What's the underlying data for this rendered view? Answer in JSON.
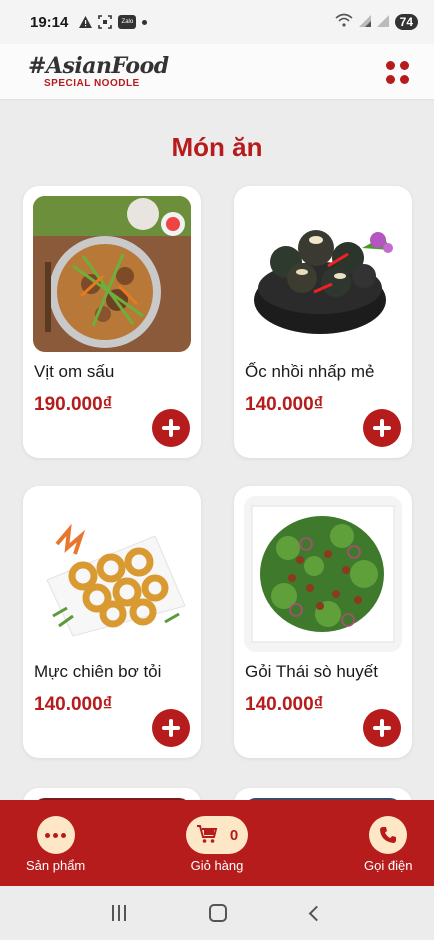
{
  "status_bar": {
    "time": "19:14",
    "battery": "74",
    "left_icons": [
      "alert-icon",
      "screenshot-icon",
      "zalo-icon",
      "dot-icon"
    ],
    "zalo_label": "Zalo"
  },
  "header": {
    "logo_main": "#AsianFood",
    "logo_sub": "SPECIAL NOODLE",
    "menu_icon": "grid-dots-icon"
  },
  "main": {
    "section_title": "Món ăn",
    "dishes": [
      {
        "name": "Vịt om sấu",
        "price": "190.000₫"
      },
      {
        "name": "Ốc nhồi nhấp mẻ",
        "price": "140.000₫"
      },
      {
        "name": "Mực chiên bơ tỏi",
        "price": "140.000₫"
      },
      {
        "name": "Gỏi Thái sò huyết",
        "price": "140.000₫"
      }
    ]
  },
  "bottom_nav": {
    "products_label": "Sản phẩm",
    "cart_label": "Giỏ hàng",
    "cart_count": "0",
    "call_label": "Gọi điện"
  },
  "colors": {
    "accent": "#b71c1c",
    "nav_button_bg": "#fde7c7",
    "page_bg": "#ececec"
  }
}
